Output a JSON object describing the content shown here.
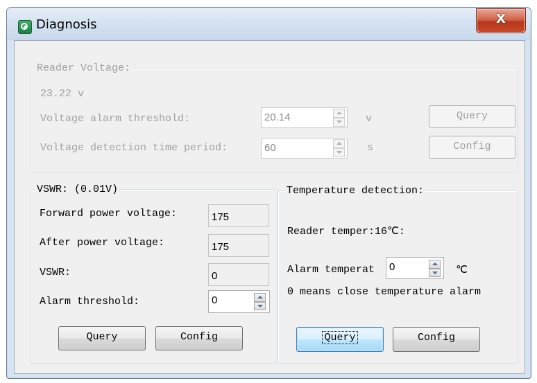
{
  "window": {
    "title": "Diagnosis",
    "close_label": "X"
  },
  "reader_voltage": {
    "legend": "Reader Voltage:",
    "value": "23.22 v",
    "alarm_label": "Voltage alarm threshold:",
    "alarm_value": "20.14",
    "alarm_unit": "v",
    "period_label": "Voltage detection time period:",
    "period_value": "60",
    "period_unit": "s",
    "query_label": "Query",
    "config_label": "Config"
  },
  "vswr": {
    "legend": "VSWR: (0.01V)",
    "forward_label": "Forward power voltage:",
    "forward_value": "175",
    "after_label": "After power voltage:",
    "after_value": "175",
    "vswr_label": "VSWR:",
    "vswr_value": "0",
    "threshold_label": "Alarm threshold:",
    "threshold_value": "0",
    "query_label": "Query",
    "config_label": "Config"
  },
  "temperature": {
    "legend": "Temperature detection:",
    "reader_temp_label": "Reader temper:16℃:",
    "alarm_label": "Alarm temperat",
    "alarm_value": "0",
    "alarm_unit": "℃",
    "note": "0 means close temperature alarm",
    "query_label": "Query",
    "config_label": "Config"
  }
}
